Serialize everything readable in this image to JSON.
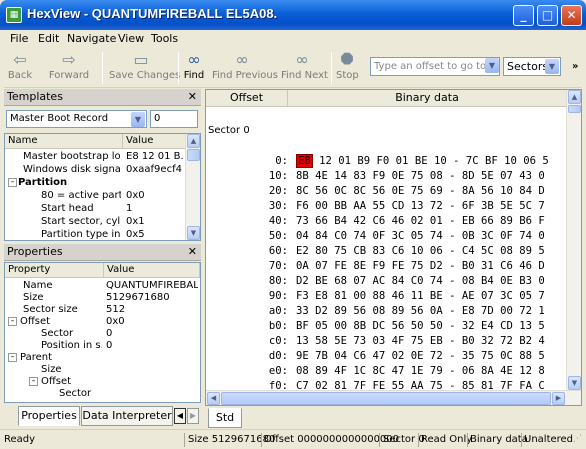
{
  "window": {
    "title": "HexView - QUANTUMFIREBALL EL5A08.",
    "icon": "hexview-app-icon",
    "minimize": "_",
    "maximize": "□",
    "close": "✕"
  },
  "menu": [
    "File",
    "Edit",
    "Navigate",
    "View",
    "Tools"
  ],
  "toolbar": {
    "back": "Back",
    "forward": "Forward",
    "save": "Save Changes",
    "find": "Find",
    "find_previous": "Find Previous",
    "find_next": "Find Next",
    "stop": "Stop",
    "goto_placeholder": "Type an offset to go to",
    "units": "Sectors",
    "overflow": "»"
  },
  "templates": {
    "title": "Templates",
    "close": "✕",
    "template_select": "Master Boot Record",
    "index": "0",
    "columns": [
      "Name",
      "Value"
    ],
    "rows": [
      {
        "name": "Master bootstrap loa...",
        "value": "E8 12 01 B..."
      },
      {
        "name": "Windows disk signat...",
        "value": "0xaaf9ecf4"
      },
      {
        "name": "Partition",
        "value": ""
      },
      {
        "name": "80 = active parti...",
        "value": "0x0"
      },
      {
        "name": "Start head",
        "value": "1"
      },
      {
        "name": "Start sector, cyli...",
        "value": "0x1"
      },
      {
        "name": "Partition type in...",
        "value": "0x5"
      }
    ]
  },
  "properties": {
    "title": "Properties",
    "close": "✕",
    "columns": [
      "Property",
      "Value"
    ],
    "rows": [
      {
        "name": "Name",
        "value": "QUANTUMFIREBALL..."
      },
      {
        "name": "Size",
        "value": "5129671680"
      },
      {
        "name": "Sector size",
        "value": "512"
      },
      {
        "name": "Offset",
        "value": "0x0"
      },
      {
        "name": "Sector",
        "value": "0"
      },
      {
        "name": "Position in s...",
        "value": "0"
      },
      {
        "name": "Parent",
        "value": ""
      },
      {
        "name": "Size",
        "value": ""
      },
      {
        "name": "Offset",
        "value": ""
      },
      {
        "name": "Sector",
        "value": ""
      }
    ],
    "tabs": [
      "Properties",
      "Data Interpreter"
    ],
    "tab_prev": "◀",
    "tab_next": "▶"
  },
  "hex": {
    "col_offset": "Offset",
    "col_binary": "Binary data",
    "sector_label": "Sector 0",
    "rows": [
      {
        "off": "0:",
        "first": "E8",
        "rest": " 12 01 B9 F0 01 BE 10 - 7C BF 10 06 5"
      },
      {
        "off": "10:",
        "first": "",
        "rest": "8B 4E 14 83 F9 0E 75 08 - 8D 5E 07 43 0"
      },
      {
        "off": "20:",
        "first": "",
        "rest": "8C 56 0C 8C 56 0E 75 69 - 8A 56 10 84 D"
      },
      {
        "off": "30:",
        "first": "",
        "rest": "F6 00 BB AA 55 CD 13 72 - 6F 3B 5E 5C 7"
      },
      {
        "off": "40:",
        "first": "",
        "rest": "73 66 B4 42 C6 46 02 01 - EB 66 89 B6 F"
      },
      {
        "off": "50:",
        "first": "",
        "rest": "04 84 C0 74 0F 3C 05 74 - 0B 3C 0F 74 0"
      },
      {
        "off": "60:",
        "first": "",
        "rest": "E2 80 75 CB 83 C6 10 06 - C4 5C 08 89 5"
      },
      {
        "off": "70:",
        "first": "",
        "rest": "0A 07 FE 8E F9 FE 75 D2 - B0 31 C6 46 D"
      },
      {
        "off": "80:",
        "first": "",
        "rest": "D2 BE 68 07 AC 84 C0 74 - 08 B4 0E B3 0"
      },
      {
        "off": "90:",
        "first": "",
        "rest": "F3 E8 81 00 88 46 11 BE - AE 07 3C 05 7"
      },
      {
        "off": "a0:",
        "first": "",
        "rest": "33 D2 89 56 08 89 56 0A - E8 7D 00 72 1"
      },
      {
        "off": "b0:",
        "first": "",
        "rest": "BF 05 00 8B DC 56 50 50 - 32 E4 CD 13 5"
      },
      {
        "off": "c0:",
        "first": "",
        "rest": "13 58 5E 73 03 4F 75 EB - B0 32 72 B2 4"
      },
      {
        "off": "d0:",
        "first": "",
        "rest": "9E 7B 04 C6 47 02 0E 72 - 35 75 0C 88 5"
      },
      {
        "off": "e0:",
        "first": "",
        "rest": "08 89 4F 1C 8C 47 1E 79 - 06 8A 4E 12 8"
      },
      {
        "off": "f0:",
        "first": "",
        "rest": "C7 02 81 7F FE 55 AA 75 - 85 81 7F FA C"
      }
    ],
    "tab": "Std"
  },
  "status": {
    "ready": "Ready",
    "size": "Size 5129671680",
    "offset": "Offset 0000000000000000",
    "sector": "Sector 0",
    "mode": "Read Only",
    "type": "Binary data",
    "state": "Unaltered"
  }
}
